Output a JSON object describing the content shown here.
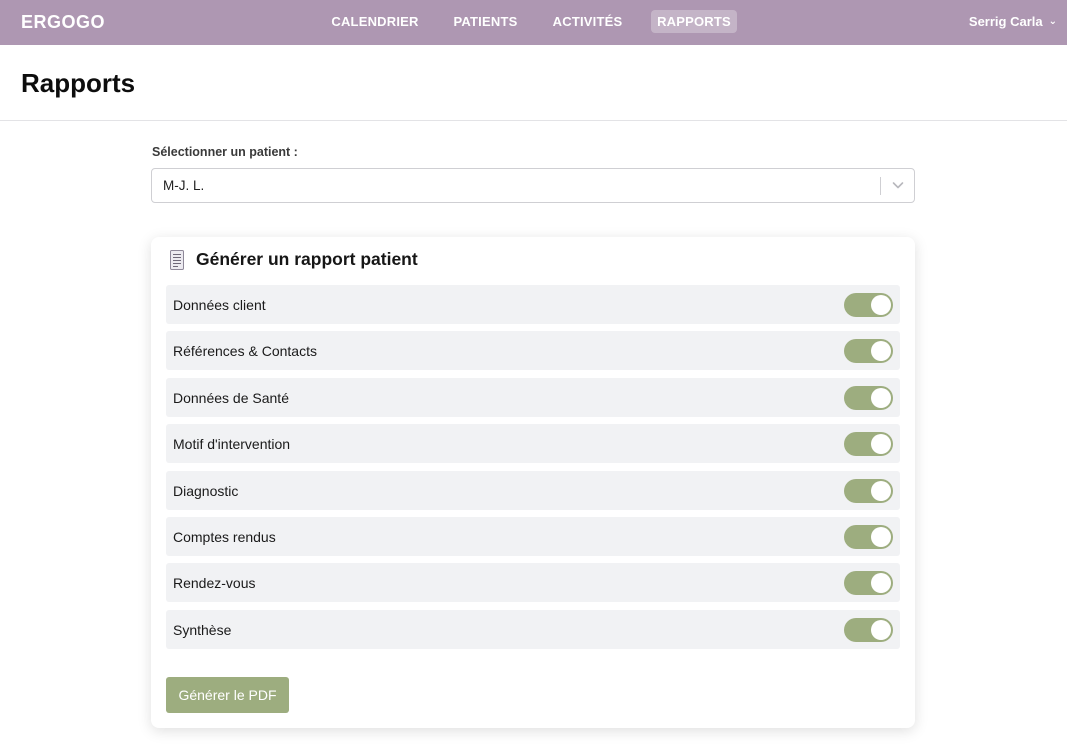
{
  "app": {
    "brand": "ERGOGO"
  },
  "nav": {
    "items": [
      {
        "label": "CALENDRIER",
        "active": false
      },
      {
        "label": "PATIENTS",
        "active": false
      },
      {
        "label": "ACTIVITÉS",
        "active": false
      },
      {
        "label": "RAPPORTS",
        "active": true
      }
    ]
  },
  "user": {
    "name": "Serrig Carla",
    "chevron": "chevron-down-icon"
  },
  "page": {
    "title": "Rapports"
  },
  "patient_select": {
    "label": "Sélectionner un patient :",
    "value": "M-J. L.",
    "icon": "chevron-down-icon"
  },
  "report": {
    "icon": "document-icon",
    "title": "Générer un rapport patient",
    "sections": [
      {
        "label": "Données client",
        "enabled": true
      },
      {
        "label": "Références & Contacts",
        "enabled": true
      },
      {
        "label": "Données de Santé",
        "enabled": true
      },
      {
        "label": "Motif d'intervention",
        "enabled": true
      },
      {
        "label": "Diagnostic",
        "enabled": true
      },
      {
        "label": "Comptes rendus",
        "enabled": true
      },
      {
        "label": "Rendez-vous",
        "enabled": true
      },
      {
        "label": "Synthèse",
        "enabled": true
      }
    ],
    "button_label": "Générer le PDF"
  },
  "colors": {
    "topbar": "#ae97b2",
    "accent_green": "#9dad7f",
    "row_bg": "#f1f2f4"
  }
}
